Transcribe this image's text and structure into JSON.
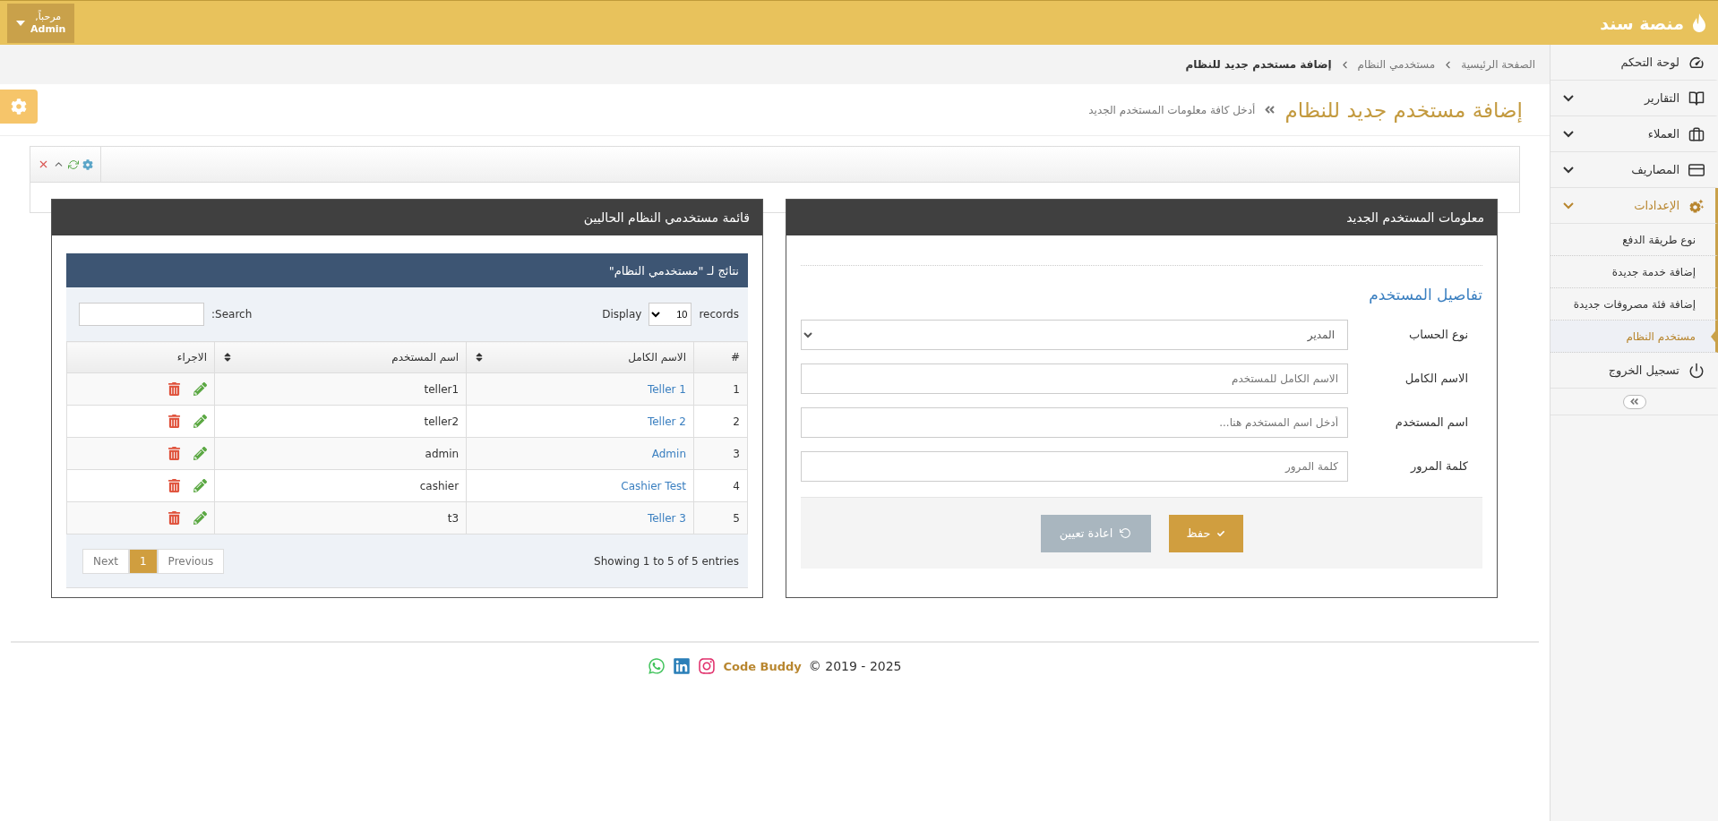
{
  "header": {
    "brand": "منصة سند",
    "greeting": "مرحباً,",
    "user": "Admin"
  },
  "sidebar": {
    "items": [
      {
        "label": "لوحة التحكم",
        "expandable": false,
        "expanded": false
      },
      {
        "label": "التقارير",
        "expandable": true,
        "expanded": false
      },
      {
        "label": "العملاء",
        "expandable": true,
        "expanded": false
      },
      {
        "label": "المصاريف",
        "expandable": true,
        "expanded": false
      },
      {
        "label": "الإعدادات",
        "expandable": true,
        "expanded": true,
        "children": [
          {
            "label": "نوع طريقة الدفع",
            "selected": false
          },
          {
            "label": "إضافة خدمة جديدة",
            "selected": false
          },
          {
            "label": "إضافة فئة مصروفات جديدة",
            "selected": false
          },
          {
            "label": "مستخدم النظام",
            "selected": true
          }
        ]
      },
      {
        "label": "تسجيل الخروج",
        "expandable": false,
        "expanded": false
      }
    ]
  },
  "breadcrumb": [
    "الصفحة الرئيسية",
    "مستخدمي النظام",
    "إضافة مستخدم جديد للنظام"
  ],
  "page": {
    "title": "إضافة مستخدم جديد للنظام",
    "subtitle": "أدخل كافة معلومات المستخدم الجديد"
  },
  "form_panel": {
    "title": "معلومات المستخدم الجديد",
    "section": "تفاصيل المستخدم",
    "fields": [
      {
        "label": "نوع الحساب",
        "kind": "select",
        "value": "المدير"
      },
      {
        "label": "الاسم الكامل",
        "kind": "text",
        "placeholder": "الاسم الكامل للمستخدم"
      },
      {
        "label": "اسم المستخدم",
        "kind": "text",
        "placeholder": "أدخل اسم المستخدم هنا..."
      },
      {
        "label": "كلمة المرور",
        "kind": "password",
        "placeholder": "كلمة المرور"
      }
    ],
    "buttons": [
      {
        "label": "حفظ",
        "kind": "save"
      },
      {
        "label": "اعادة تعيين",
        "kind": "reset"
      }
    ]
  },
  "list_panel": {
    "title": "قائمة مستخدمي النظام الحاليين",
    "caption": "نتائج لـ \"مستخدمي النظام\"",
    "records_label": "records",
    "page_size": "10",
    "display_label": "Display",
    "search_label": "Search:",
    "columns": [
      {
        "label": "#",
        "sortable": false
      },
      {
        "label": "الاسم الكامل",
        "sortable": true
      },
      {
        "label": "اسم المستخدم",
        "sortable": true
      },
      {
        "label": "الاجراء",
        "sortable": false
      }
    ],
    "rows": [
      {
        "num": "1",
        "full_name": "Teller 1",
        "username": "teller1"
      },
      {
        "num": "2",
        "full_name": "Teller 2",
        "username": "teller2"
      },
      {
        "num": "3",
        "full_name": "Admin",
        "username": "admin"
      },
      {
        "num": "4",
        "full_name": "Cashier Test",
        "username": "cashier"
      },
      {
        "num": "5",
        "full_name": "Teller 3",
        "username": "t3"
      }
    ],
    "info": "Showing 1 to 5 of 5 entries",
    "pagination": [
      {
        "label": "Previous",
        "selected": false
      },
      {
        "label": "1",
        "selected": true
      },
      {
        "label": "Next",
        "selected": false
      }
    ]
  },
  "footer": {
    "brand": "Code Buddy",
    "copyright": "© 2019 - 2025"
  }
}
